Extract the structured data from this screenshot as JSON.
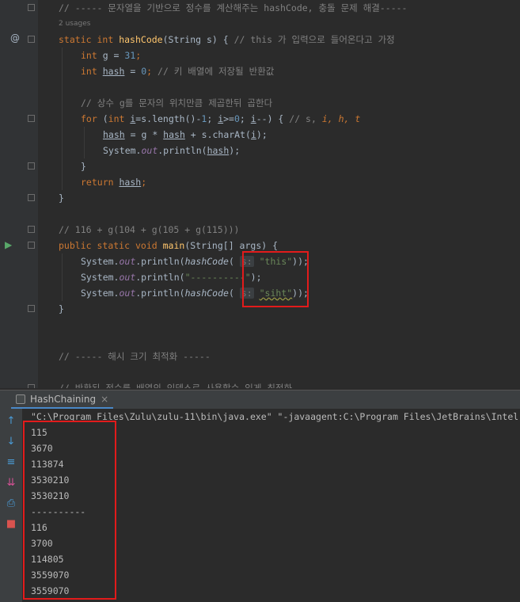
{
  "editor": {
    "comment_top": "// ----- 문자열을 기반으로 정수를 계산해주는 hashCode, 충돌 문제 해결-----",
    "usages": "2 usages",
    "sig_static": "static",
    "sig_int": "int",
    "sig_name": "hashCode",
    "sig_params": "(String s) {",
    "sig_comment": "// this 가 입력으로 들어온다고 가정",
    "g_int": "int",
    "g_rest": " g = ",
    "g_val": "31",
    "g_end": ";",
    "h_int": "int",
    "h_var": "hash",
    "h_eq": " = ",
    "h_val": "0",
    "h_end": ";",
    "h_comment": "// 키 배열에 저장될 반환값",
    "loop_comment": "// 상수 g를 문자의 위치만큼 제곱한뒤 곱한다",
    "for_kw": "for",
    "for_open": " (",
    "for_int": "int",
    "for_i1": "i",
    "for_a": "=s.length()-",
    "for_one": "1",
    "for_b": "; ",
    "for_i2": "i",
    "for_c": ">=",
    "for_zero": "0",
    "for_d": "; ",
    "for_i3": "i",
    "for_e": "--) { ",
    "for_comment": "// s, ",
    "for_inlay": "i, h, t",
    "body1_hash": "hash",
    "body1_mid": " = g * ",
    "body1_hash2": "hash",
    "body1_rest": " + s.charAt(",
    "body1_i": "i",
    "body1_end": ");",
    "body2_a": "System.",
    "body2_out": "out",
    "body2_b": ".println(",
    "body2_hash": "hash",
    "body2_end": ");",
    "brace": "}",
    "ret_kw": "return",
    "ret_var": "hash",
    "ret_end": ";",
    "comment_calc": "// 116 + g(104 + g(105 + g(115)))",
    "main_public": "public",
    "main_static": "static",
    "main_void": "void",
    "main_name": "main",
    "main_params": "(String[] args) {",
    "p1_a": "System.",
    "p1_out": "out",
    "p1_b": ".println(",
    "p1_call": "hashCode",
    "p1_paren": "(",
    "p1_hint": "s:",
    "p1_str": "\"this\"",
    "p1_end": "));",
    "p2_a": "System.",
    "p2_out": "out",
    "p2_b": ".println(",
    "p2_str": "\"----------\"",
    "p2_end": ");",
    "p3_a": "System.",
    "p3_out": "out",
    "p3_b": ".println(",
    "p3_call": "hashCode",
    "p3_paren": "(",
    "p3_hint": "s:",
    "p3_str": "\"siht\"",
    "p3_end": "));",
    "comment_section": "// ----- 해시 크기 최적화 -----",
    "comment_cut": "// 반환된 정수를 배열의 인덱스로 사용할수 있게 최적화"
  },
  "gutter": {
    "at_icon": "@",
    "run_icon": "▶"
  },
  "run_panel": {
    "tab_label": "HashChaining",
    "close": "×",
    "command": "\"C:\\Program Files\\Zulu\\zulu-11\\bin\\java.exe\" \"-javaagent:C:\\Program Files\\JetBrains\\Intel",
    "output": [
      "115",
      "3670",
      "113874",
      "3530210",
      "3530210",
      "----------",
      "116",
      "3700",
      "114805",
      "3559070",
      "3559070"
    ]
  },
  "colors": {
    "accent": "#4a88c7",
    "highlight_box": "#e21b1b",
    "run_green": "#59a869"
  }
}
